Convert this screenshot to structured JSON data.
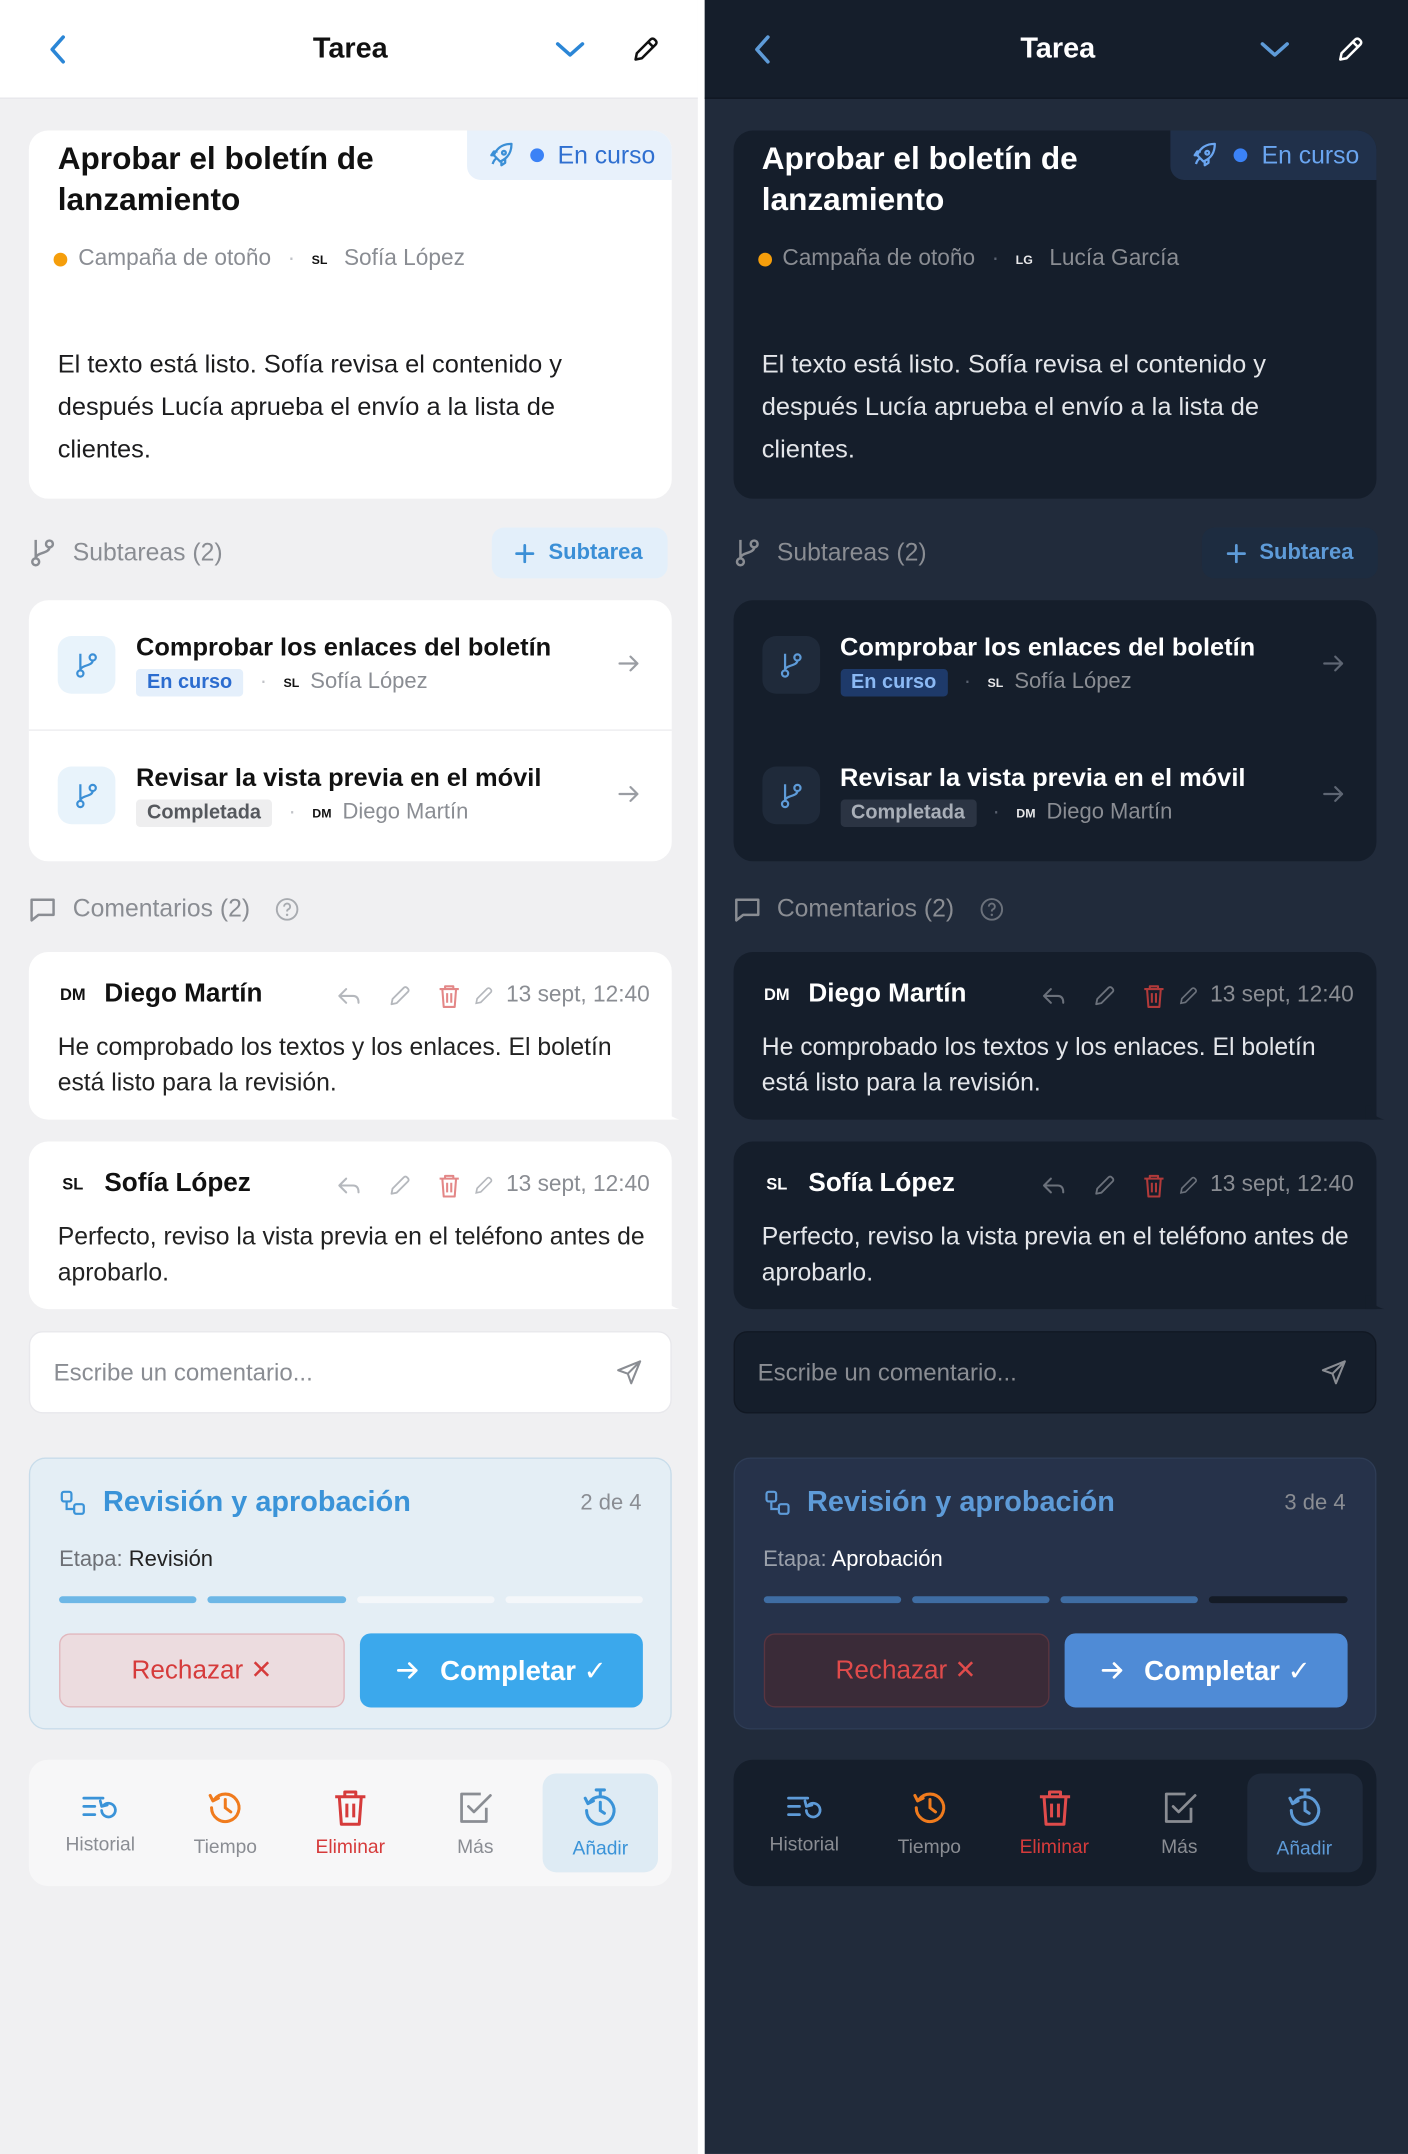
{
  "header": {
    "title": "Tarea"
  },
  "task": {
    "title": "Aprobar el boletín de lanzamiento",
    "status": "En curso",
    "project": "Campaña de otoño",
    "description": "El texto está listo. Sofía revisa el contenido y después Lucía aprueba el envío a la lista de clientes."
  },
  "variants": {
    "light": {
      "assignee_initials": "SL",
      "assignee": "Sofía López",
      "workflow_count": "2 de 4",
      "workflow_stage": "Revisión",
      "workflow_progress": 0.5
    },
    "dark": {
      "assignee_initials": "LG",
      "assignee": "Lucía García",
      "workflow_count": "3 de 4",
      "workflow_stage": "Aprobación",
      "workflow_progress": 0.75
    }
  },
  "subtasks": {
    "header": "Subtareas (2)",
    "add_label": "Subtarea",
    "items": [
      {
        "title": "Comprobar los enlaces del boletín",
        "status": "En curso",
        "assignee_initials": "SL",
        "assignee": "Sofía López"
      },
      {
        "title": "Revisar la vista previa en el móvil",
        "status": "Completada",
        "assignee_initials": "DM",
        "assignee": "Diego Martín"
      }
    ]
  },
  "comments": {
    "header": "Comentarios (2)",
    "items": [
      {
        "initials": "DM",
        "author": "Diego Martín",
        "date": "13 sept, 12:40",
        "text": "He comprobado los textos y los enlaces. El boletín está listo para la revisión."
      },
      {
        "initials": "SL",
        "author": "Sofía López",
        "date": "13 sept, 12:40",
        "text": "Perfecto, reviso la vista previa en el teléfono antes de aprobarlo."
      }
    ],
    "placeholder": "Escribe un comentario..."
  },
  "workflow": {
    "title": "Revisión y aprobación",
    "stage_label": "Etapa:",
    "reject_label": "Rechazar ✕",
    "complete_label": "Completar ✓"
  },
  "toolbar": {
    "history": "Historial",
    "time": "Tiempo",
    "delete": "Eliminar",
    "more": "Más",
    "add": "Añadir"
  },
  "colors": {
    "accent": "#3a93d8",
    "status_blue": "#3b82f6",
    "project_orange": "#f59e0b",
    "danger": "#d63b3b",
    "icons": [
      "chevron-left-icon",
      "chevron-down-icon",
      "pencil-icon",
      "rocket-icon",
      "branch-icon",
      "plus-icon",
      "arrow-right-icon",
      "comment-icon",
      "help-icon",
      "reply-icon",
      "trash-icon",
      "send-icon",
      "workflow-icon",
      "history-icon",
      "timer-icon",
      "checkbox-icon",
      "stopwatch-icon"
    ]
  }
}
